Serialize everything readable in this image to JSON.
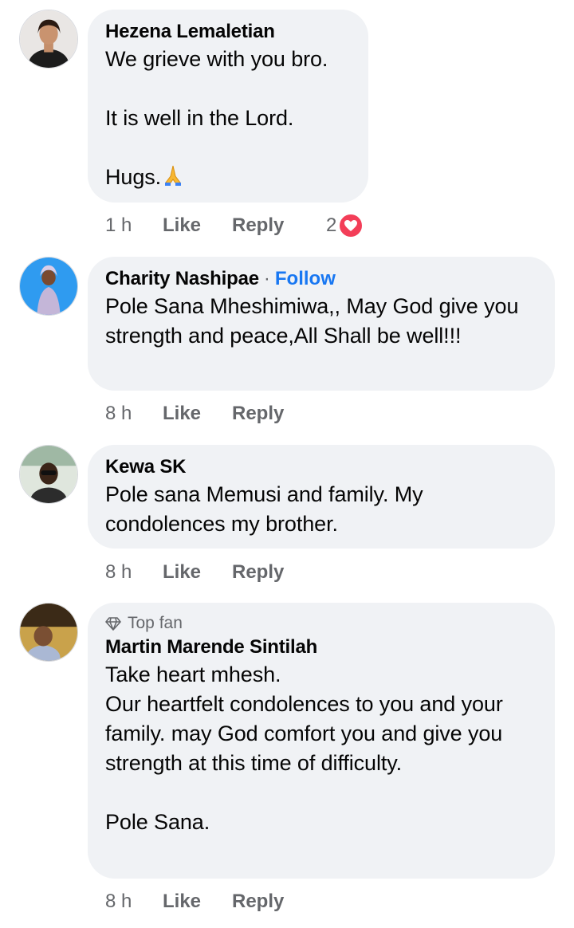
{
  "comments": [
    {
      "author": "Hezena Lemaletian",
      "lines": [
        "We grieve with you bro.",
        "",
        "It is well in the Lord.",
        "",
        "Hugs."
      ],
      "emoji": "folded-hands-icon",
      "time": "1 h",
      "like_label": "Like",
      "reply_label": "Reply",
      "reaction_count": "2",
      "reaction_icon": "love-reaction-icon"
    },
    {
      "author": "Charity Nashipae",
      "separator": "·",
      "follow_label": "Follow",
      "text": "Pole Sana Mheshimiwa,, May God give you strength and peace,All Shall be well!!!",
      "time": "8 h",
      "like_label": "Like",
      "reply_label": "Reply"
    },
    {
      "author": "Kewa SK",
      "text": "Pole sana Memusi and family.  My condolences my brother.",
      "time": "8 h",
      "like_label": "Like",
      "reply_label": "Reply"
    },
    {
      "badge": "Top fan",
      "badge_icon": "diamond-icon",
      "author": "Martin Marende Sintilah",
      "text": "Take heart mhesh.\nOur heartfelt condolences to you and your family. may God comfort you and give you strength at this time of difficulty.\n\nPole Sana.",
      "time": "8 h",
      "like_label": "Like",
      "reply_label": "Reply"
    }
  ],
  "colors": {
    "bubble": "#f0f2f5",
    "follow": "#1877f2",
    "secondary_text": "#65676b",
    "love_reaction": "#f33e58"
  }
}
